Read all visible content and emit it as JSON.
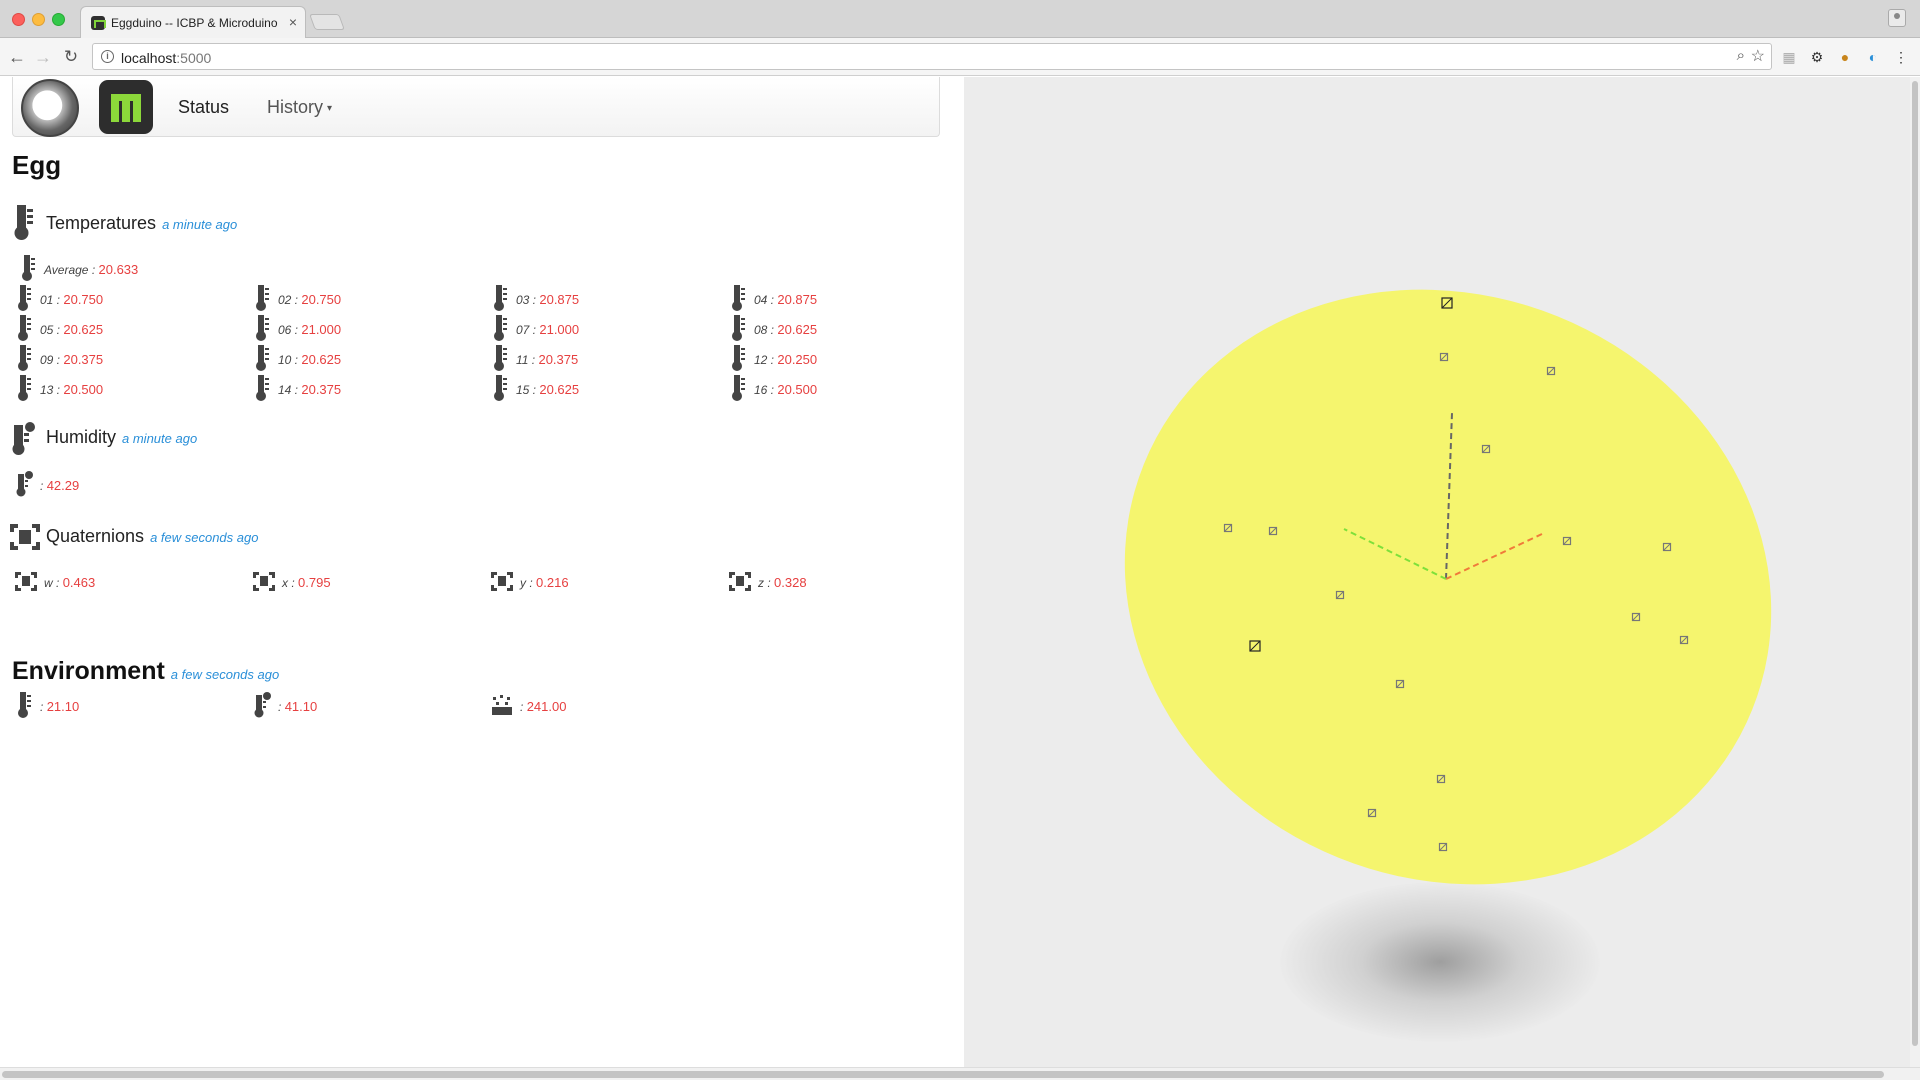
{
  "browser": {
    "tab_title": "Eggduino -- ICBP & Microduino",
    "tab_close": "×",
    "url_host": "localhost",
    "url_port": ":5000"
  },
  "nav": {
    "status": "Status",
    "history": "History"
  },
  "egg": {
    "title": "Egg",
    "temperatures": {
      "label": "Temperatures",
      "time": "a minute ago",
      "average_label": "Average :",
      "average_value": "20.633",
      "sensors": [
        {
          "id": "01 :",
          "value": "20.750"
        },
        {
          "id": "02 :",
          "value": "20.750"
        },
        {
          "id": "03 :",
          "value": "20.875"
        },
        {
          "id": "04 :",
          "value": "20.875"
        },
        {
          "id": "05 :",
          "value": "20.625"
        },
        {
          "id": "06 :",
          "value": "21.000"
        },
        {
          "id": "07 :",
          "value": "21.000"
        },
        {
          "id": "08 :",
          "value": "20.625"
        },
        {
          "id": "09 :",
          "value": "20.375"
        },
        {
          "id": "10 :",
          "value": "20.625"
        },
        {
          "id": "11 :",
          "value": "20.375"
        },
        {
          "id": "12 :",
          "value": "20.250"
        },
        {
          "id": "13 :",
          "value": "20.500"
        },
        {
          "id": "14 :",
          "value": "20.375"
        },
        {
          "id": "15 :",
          "value": "20.625"
        },
        {
          "id": "16 :",
          "value": "20.500"
        }
      ]
    },
    "humidity": {
      "label": "Humidity",
      "time": "a minute ago",
      "reading_label": ":",
      "value": "42.29"
    },
    "quaternions": {
      "label": "Quaternions",
      "time": "a few seconds ago",
      "values": [
        {
          "id": "w :",
          "value": "0.463"
        },
        {
          "id": "x :",
          "value": "0.795"
        },
        {
          "id": "y :",
          "value": "0.216"
        },
        {
          "id": "z :",
          "value": "0.328"
        }
      ]
    }
  },
  "environment": {
    "title": "Environment",
    "time": "a few seconds ago",
    "temperature": {
      "label": ":",
      "value": "21.10"
    },
    "humidity": {
      "label": ":",
      "value": "41.10"
    },
    "pressure": {
      "label": ":",
      "value": "241.00"
    }
  },
  "colors": {
    "egg_fill": "#f5f56e",
    "value_red": "#e64040",
    "time_blue": "#2a8fd8",
    "axis_x": "#f07a3a",
    "axis_y": "#7ee03a",
    "axis_z": "#666666"
  },
  "icons": {
    "thermometer": "thermometer-icon",
    "humidity": "humidity-icon",
    "quaternion": "quaternion-icon",
    "pressure": "pressure-icon"
  }
}
